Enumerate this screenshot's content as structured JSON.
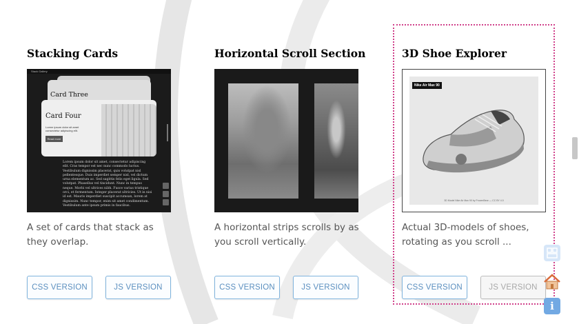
{
  "cards": [
    {
      "title": "Stacking Cards",
      "description": "A set of cards that stack as they overlap.",
      "css_button": "CSS VERSION",
      "js_button": "JS VERSION",
      "thumbnail": {
        "window_label": "Stack Gallery",
        "card_three_title": "Card Three",
        "card_four_title": "Card Four",
        "card_four_text": "Lorem ipsum dolor sit amet consectetur adipiscing elit.",
        "read_more": "Read more",
        "lorem": "Lorem ipsum dolor sit amet, consectetur adipiscing elit. Cras tempor est nec nunc commodo luctus. Vestibulum dignissim placerat, quis volutpat nisl pellentesque. Duis imperdiet semper nisl, vel dictum urna elementum ac. Sed sagittis felis eget ligula. Sed volutpat. Phasellus vel tincidunt. Nunc in tempus neque. Morbi vel ultrices nibh. Fusce varius tristique orci, et fermentum. Integer placerat ultricies. Ut in nisi id est. Mauris imperdiet suscipit accumsan, lorem at dignissim. Nunc tempor, enim sit amet condimentum. Vestibulum ante ipsum primis in faucibus."
      }
    },
    {
      "title": "Horizontal Scroll Section",
      "description": "A horizontal strips scrolls by as you scroll vertically.",
      "css_button": "CSS VERSION",
      "js_button": "JS VERSION"
    },
    {
      "title": "3D Shoe Explorer",
      "description": "Actual 3D-models of shoes, rotating as you scroll ...",
      "css_button": "CSS VERSION",
      "js_button": "JS VERSION",
      "thumbnail": {
        "model_tag": "Nike Air Max 90",
        "credit": "3D Model Nike Air Max 90 by FrozenBear — CC BY 4.0"
      }
    }
  ],
  "floating_buttons": {
    "info_label": "i"
  }
}
